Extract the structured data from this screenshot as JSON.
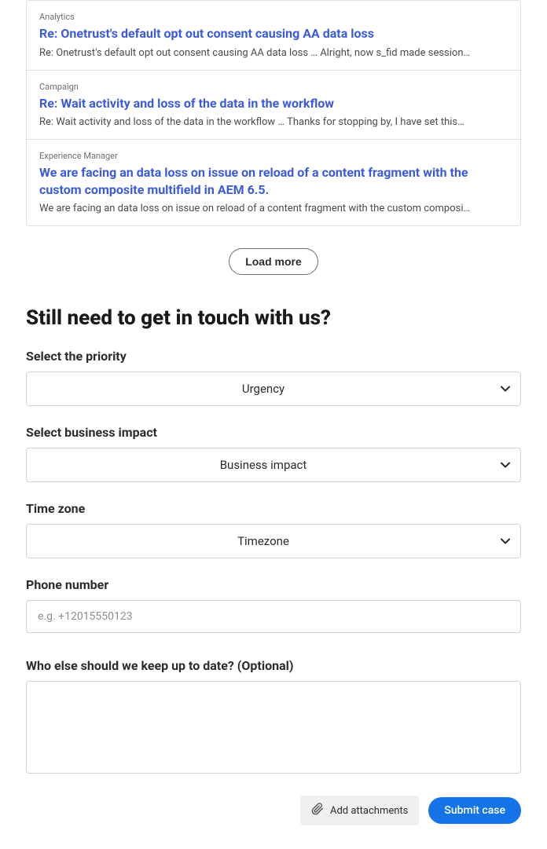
{
  "results": [
    {
      "category": "Analytics",
      "title": "Re: Onetrust's default opt out consent causing AA data loss",
      "snippet": "Re: Onetrust's default opt out consent causing AA data loss … Alright, now s_fid made session…"
    },
    {
      "category": "Campaign",
      "title": "Re: Wait activity and loss of the data in the workflow",
      "snippet": "Re: Wait activity and loss of the data in the workflow … Thanks for stopping by, I have set this…"
    },
    {
      "category": "Experience Manager",
      "title": "We are facing an data loss on issue on reload of a content fragment with the custom composite multifield in AEM 6.5.",
      "snippet": "We are facing an data loss on issue on reload of a content fragment with the custom composi…"
    }
  ],
  "load_more_label": "Load more",
  "form": {
    "heading": "Still need to get in touch with us?",
    "priority_label": "Select the priority",
    "priority_value": "Urgency",
    "impact_label": "Select business impact",
    "impact_value": "Business impact",
    "timezone_label": "Time zone",
    "timezone_value": "Timezone",
    "phone_label": "Phone number",
    "phone_placeholder": "e.g. +12015550123",
    "cc_label": "Who else should we keep up to date? (Optional)"
  },
  "actions": {
    "attach_label": "Add attachments",
    "submit_label": "Submit case"
  }
}
